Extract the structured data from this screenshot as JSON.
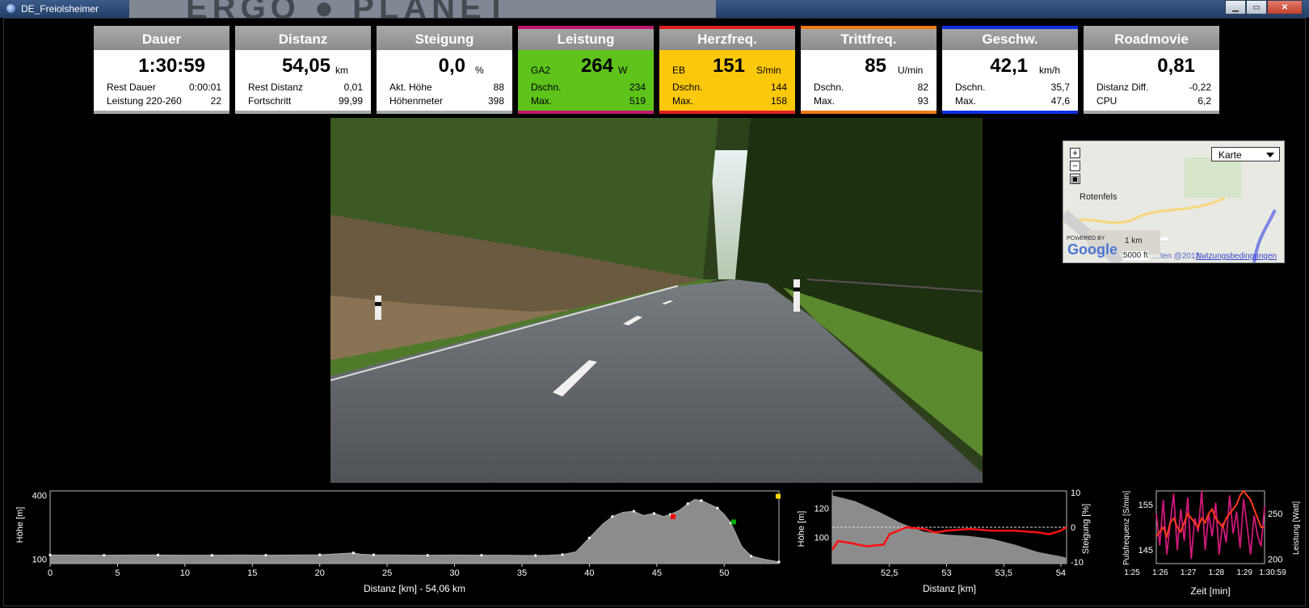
{
  "window": {
    "title": "DE_Freiolsheimer",
    "min": "▁",
    "max": "▭",
    "close": "✕"
  },
  "tiles": [
    {
      "id": "dauer",
      "head": "Dauer",
      "tag": "",
      "big": "1:30:59",
      "unit": "",
      "r1l": "Rest Dauer",
      "r1v": "0:00:01",
      "r2l": "Leistung 220-260",
      "r2v": "22",
      "color": "#a8a8a8",
      "bg": "#ffffff"
    },
    {
      "id": "distanz",
      "head": "Distanz",
      "tag": "",
      "big": "54,05",
      "unit": "km",
      "r1l": "Rest Distanz",
      "r1v": "0,01",
      "r2l": "Fortschritt",
      "r2v": "99,99",
      "color": "#a8a8a8",
      "bg": "#ffffff"
    },
    {
      "id": "steigung",
      "head": "Steigung",
      "tag": "",
      "big": "0,0",
      "unit": "%",
      "r1l": "Akt. Höhe",
      "r1v": "88",
      "r2l": "Höhenmeter",
      "r2v": "398",
      "color": "#a8a8a8",
      "bg": "#ffffff"
    },
    {
      "id": "leistung",
      "head": "Leistung",
      "tag": "GA2",
      "big": "264",
      "unit": "W",
      "r1l": "Dschn.",
      "r1v": "234",
      "r2l": "Max.",
      "r2v": "519",
      "color": "#c0186c",
      "bg": "#5ec31b"
    },
    {
      "id": "herzfreq",
      "head": "Herzfreq.",
      "tag": "EB",
      "big": "151",
      "unit": "S/min",
      "r1l": "Dschn.",
      "r1v": "144",
      "r2l": "Max.",
      "r2v": "158",
      "color": "#e02020",
      "bg": "#fcc80c"
    },
    {
      "id": "trittfreq",
      "head": "Trittfreq.",
      "tag": "",
      "big": "85",
      "unit": "U/min",
      "r1l": "Dschn.",
      "r1v": "82",
      "r2l": "Max.",
      "r2v": "93",
      "color": "#ef7b14",
      "bg": "#ffffff"
    },
    {
      "id": "geschw",
      "head": "Geschw.",
      "tag": "",
      "big": "42,1",
      "unit": "km/h",
      "r1l": "Dschn.",
      "r1v": "35,7",
      "r2l": "Max.",
      "r2v": "47,6",
      "color": "#1030e0",
      "bg": "#ffffff"
    },
    {
      "id": "roadmovie",
      "head": "Roadmovie",
      "tag": "",
      "big": "0,81",
      "unit": "",
      "r1l": "Distanz Diff.",
      "r1v": "-0,22",
      "r2l": "CPU",
      "r2v": "6,2",
      "color": "#a8a8a8",
      "bg": "#ffffff"
    }
  ],
  "map": {
    "select": "Karte",
    "place": "Rotenfels",
    "zoom_in": "+",
    "zoom_out": "−",
    "center": "▣",
    "scale_km": "1 km",
    "scale_ft": "5000 ft",
    "attribution": "…ten @2012 - ",
    "terms": "Nutzungsbedingungen",
    "powered": "POWERED BY",
    "google": "Google"
  },
  "chart_data": [
    {
      "type": "area",
      "xlabel": "Distanz [km] - 54,06 km",
      "ylabel": "Höhe [m]",
      "xlim": [
        0,
        54.06
      ],
      "ylim": [
        80,
        420
      ],
      "xticks": [
        0,
        5,
        10,
        15,
        20,
        25,
        30,
        35,
        40,
        45,
        50
      ],
      "yticks": [
        100,
        400
      ],
      "x": [
        0,
        2,
        4,
        6,
        8,
        10,
        12,
        14,
        16,
        18,
        20,
        22,
        22.5,
        23,
        24,
        26,
        28,
        30,
        32,
        34,
        36,
        37,
        38,
        39,
        40,
        41,
        41.7,
        42.5,
        43.3,
        44,
        44.8,
        45.5,
        46,
        46.7,
        47.3,
        47.8,
        48.3,
        49,
        49.5,
        50,
        50.5,
        51.3,
        52,
        53,
        54.06
      ],
      "y": [
        120,
        120,
        119,
        120,
        120,
        119,
        119,
        120,
        119,
        120,
        121,
        128,
        130,
        124,
        121,
        120,
        119,
        120,
        119,
        119,
        118,
        119,
        122,
        135,
        200,
        265,
        300,
        320,
        325,
        305,
        315,
        300,
        310,
        330,
        360,
        380,
        375,
        355,
        340,
        310,
        270,
        160,
        115,
        100,
        88
      ],
      "markers": [
        {
          "x": 46.2,
          "y": 300,
          "color": "#ff0000"
        },
        {
          "x": 50.7,
          "y": 275,
          "color": "#00aa00"
        },
        {
          "x": 54,
          "y": 395,
          "color": "#ffd700"
        }
      ]
    },
    {
      "type": "line",
      "xlabel": "Distanz [km]",
      "ylabel": "Höhe [m]",
      "y2label": "Steigung [%]",
      "xlim": [
        52.0,
        54.05
      ],
      "ylim": [
        82,
        132
      ],
      "y2lim": [
        -10.5,
        10.5
      ],
      "xticks": [
        52.5,
        53,
        53.5,
        54
      ],
      "xticklabels": [
        "52,5",
        "53",
        "53,5",
        "54"
      ],
      "yticks": [
        100,
        120
      ],
      "y2ticks": [
        10,
        0,
        -10
      ],
      "elevation": {
        "x": [
          52.0,
          52.2,
          52.4,
          52.6,
          52.8,
          53.0,
          53.2,
          53.4,
          53.6,
          53.8,
          54.0,
          54.05
        ],
        "y": [
          129,
          125,
          118,
          110,
          104,
          102,
          101,
          99,
          95,
          90,
          87,
          86
        ]
      },
      "slope": {
        "x": [
          52.0,
          52.05,
          52.15,
          52.3,
          52.45,
          52.5,
          52.65,
          52.8,
          52.9,
          53.0,
          53.2,
          53.4,
          53.6,
          53.8,
          53.9,
          54.0,
          54.05
        ],
        "y": [
          -6.5,
          -4,
          -4.5,
          -5.5,
          -5,
          -2,
          0,
          -0.5,
          -1.5,
          -1,
          -0.5,
          -1,
          -1,
          -1.5,
          -2,
          -1,
          0
        ]
      }
    },
    {
      "type": "line",
      "xlabel": "Zeit [min]",
      "ylabel": "Pulsfrequenz [S/min]",
      "y2label": "Leistung [Watt]",
      "xlim": [
        1.25,
        1.51
      ],
      "ylim": [
        142,
        158
      ],
      "y2lim": [
        195,
        275
      ],
      "xticklabels": [
        "1:25",
        "1:26",
        "1:27",
        "1:28",
        "1:29",
        "1:30:59"
      ],
      "yticks": [
        145,
        155
      ],
      "y2ticks": [
        200,
        250
      ],
      "pulse": [
        148,
        149,
        150,
        148,
        151,
        152,
        150,
        149,
        151,
        153,
        152,
        151,
        150,
        152,
        151,
        153,
        154,
        152,
        151,
        150,
        152,
        153,
        154,
        155,
        157,
        158,
        157,
        156,
        154,
        152,
        150,
        150
      ],
      "power": [
        250,
        215,
        265,
        205,
        240,
        272,
        210,
        255,
        220,
        268,
        200,
        245,
        230,
        275,
        210,
        250,
        225,
        262,
        205,
        240,
        218,
        270,
        228,
        252,
        212,
        266,
        236,
        205,
        248,
        226,
        214,
        258
      ]
    }
  ]
}
